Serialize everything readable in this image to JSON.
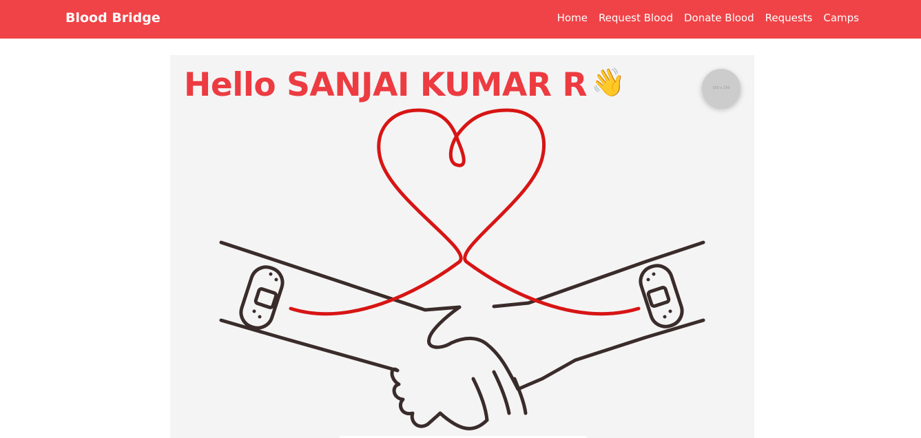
{
  "navbar": {
    "brand": "Blood Bridge",
    "links": [
      "Home",
      "Request Blood",
      "Donate Blood",
      "Requests",
      "Camps"
    ],
    "color": "#f04347"
  },
  "hero": {
    "greeting": "Hello SANJAI KUMAR R",
    "wave_emoji": "👋",
    "avatar_placeholder": "150 x 150",
    "illustration_icon": "heart-handshake-blood-donation-illustration"
  }
}
